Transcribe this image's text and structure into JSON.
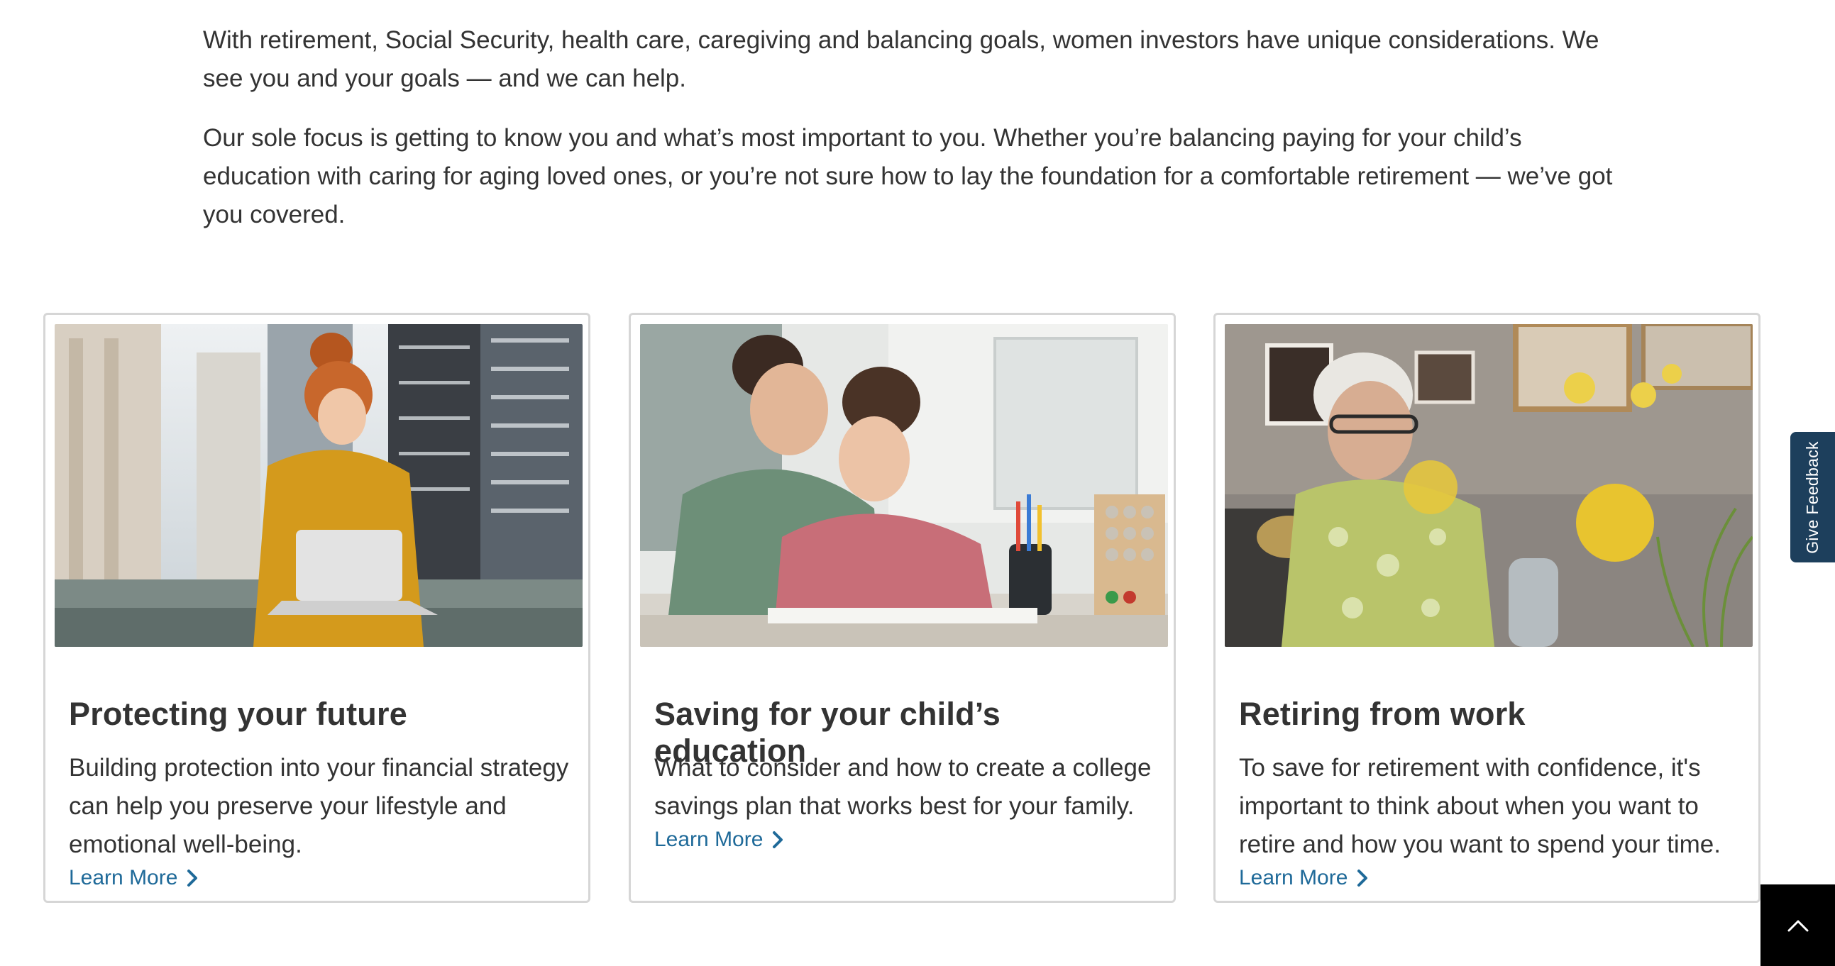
{
  "intro": {
    "paragraph_1": "With retirement, Social Security, health care, caregiving and balancing goals, women investors have unique considerations. We see you and your goals — and we can help.",
    "paragraph_2": "Our sole focus is getting to know you and what’s most important to you. Whether you’re balancing paying for your child’s education with caring for aging loved ones, or you’re not sure how to lay the foundation for a comfortable retirement — we’ve got you covered."
  },
  "cards": [
    {
      "title": "Protecting your future",
      "text": "Building protection into your financial strategy can help you preserve your lifestyle and emotional well-being.",
      "link_label": "Learn More",
      "image_alt": "woman-with-laptop-photo"
    },
    {
      "title": "Saving for your child’s education",
      "text": "What to consider and how to create a college savings plan that works best for your family.",
      "link_label": "Learn More",
      "image_alt": "mother-and-daughter-studying-photo"
    },
    {
      "title": "Retiring from work",
      "text": "To save for retirement with confidence, it's important to think about when you want to retire and how you want to spend your time.",
      "link_label": "Learn More",
      "image_alt": "older-woman-arranging-flowers-photo"
    }
  ],
  "feedback": {
    "label": "Give Feedback"
  },
  "icons": {
    "learn_more": "chevron-right-icon",
    "back_to_top": "chevron-up-icon"
  },
  "colors": {
    "link": "#1f6a99",
    "feedback_bg": "#1d3f5c",
    "back_to_top_bg": "#000000",
    "card_border": "#d6d6d6",
    "text": "#333333"
  }
}
